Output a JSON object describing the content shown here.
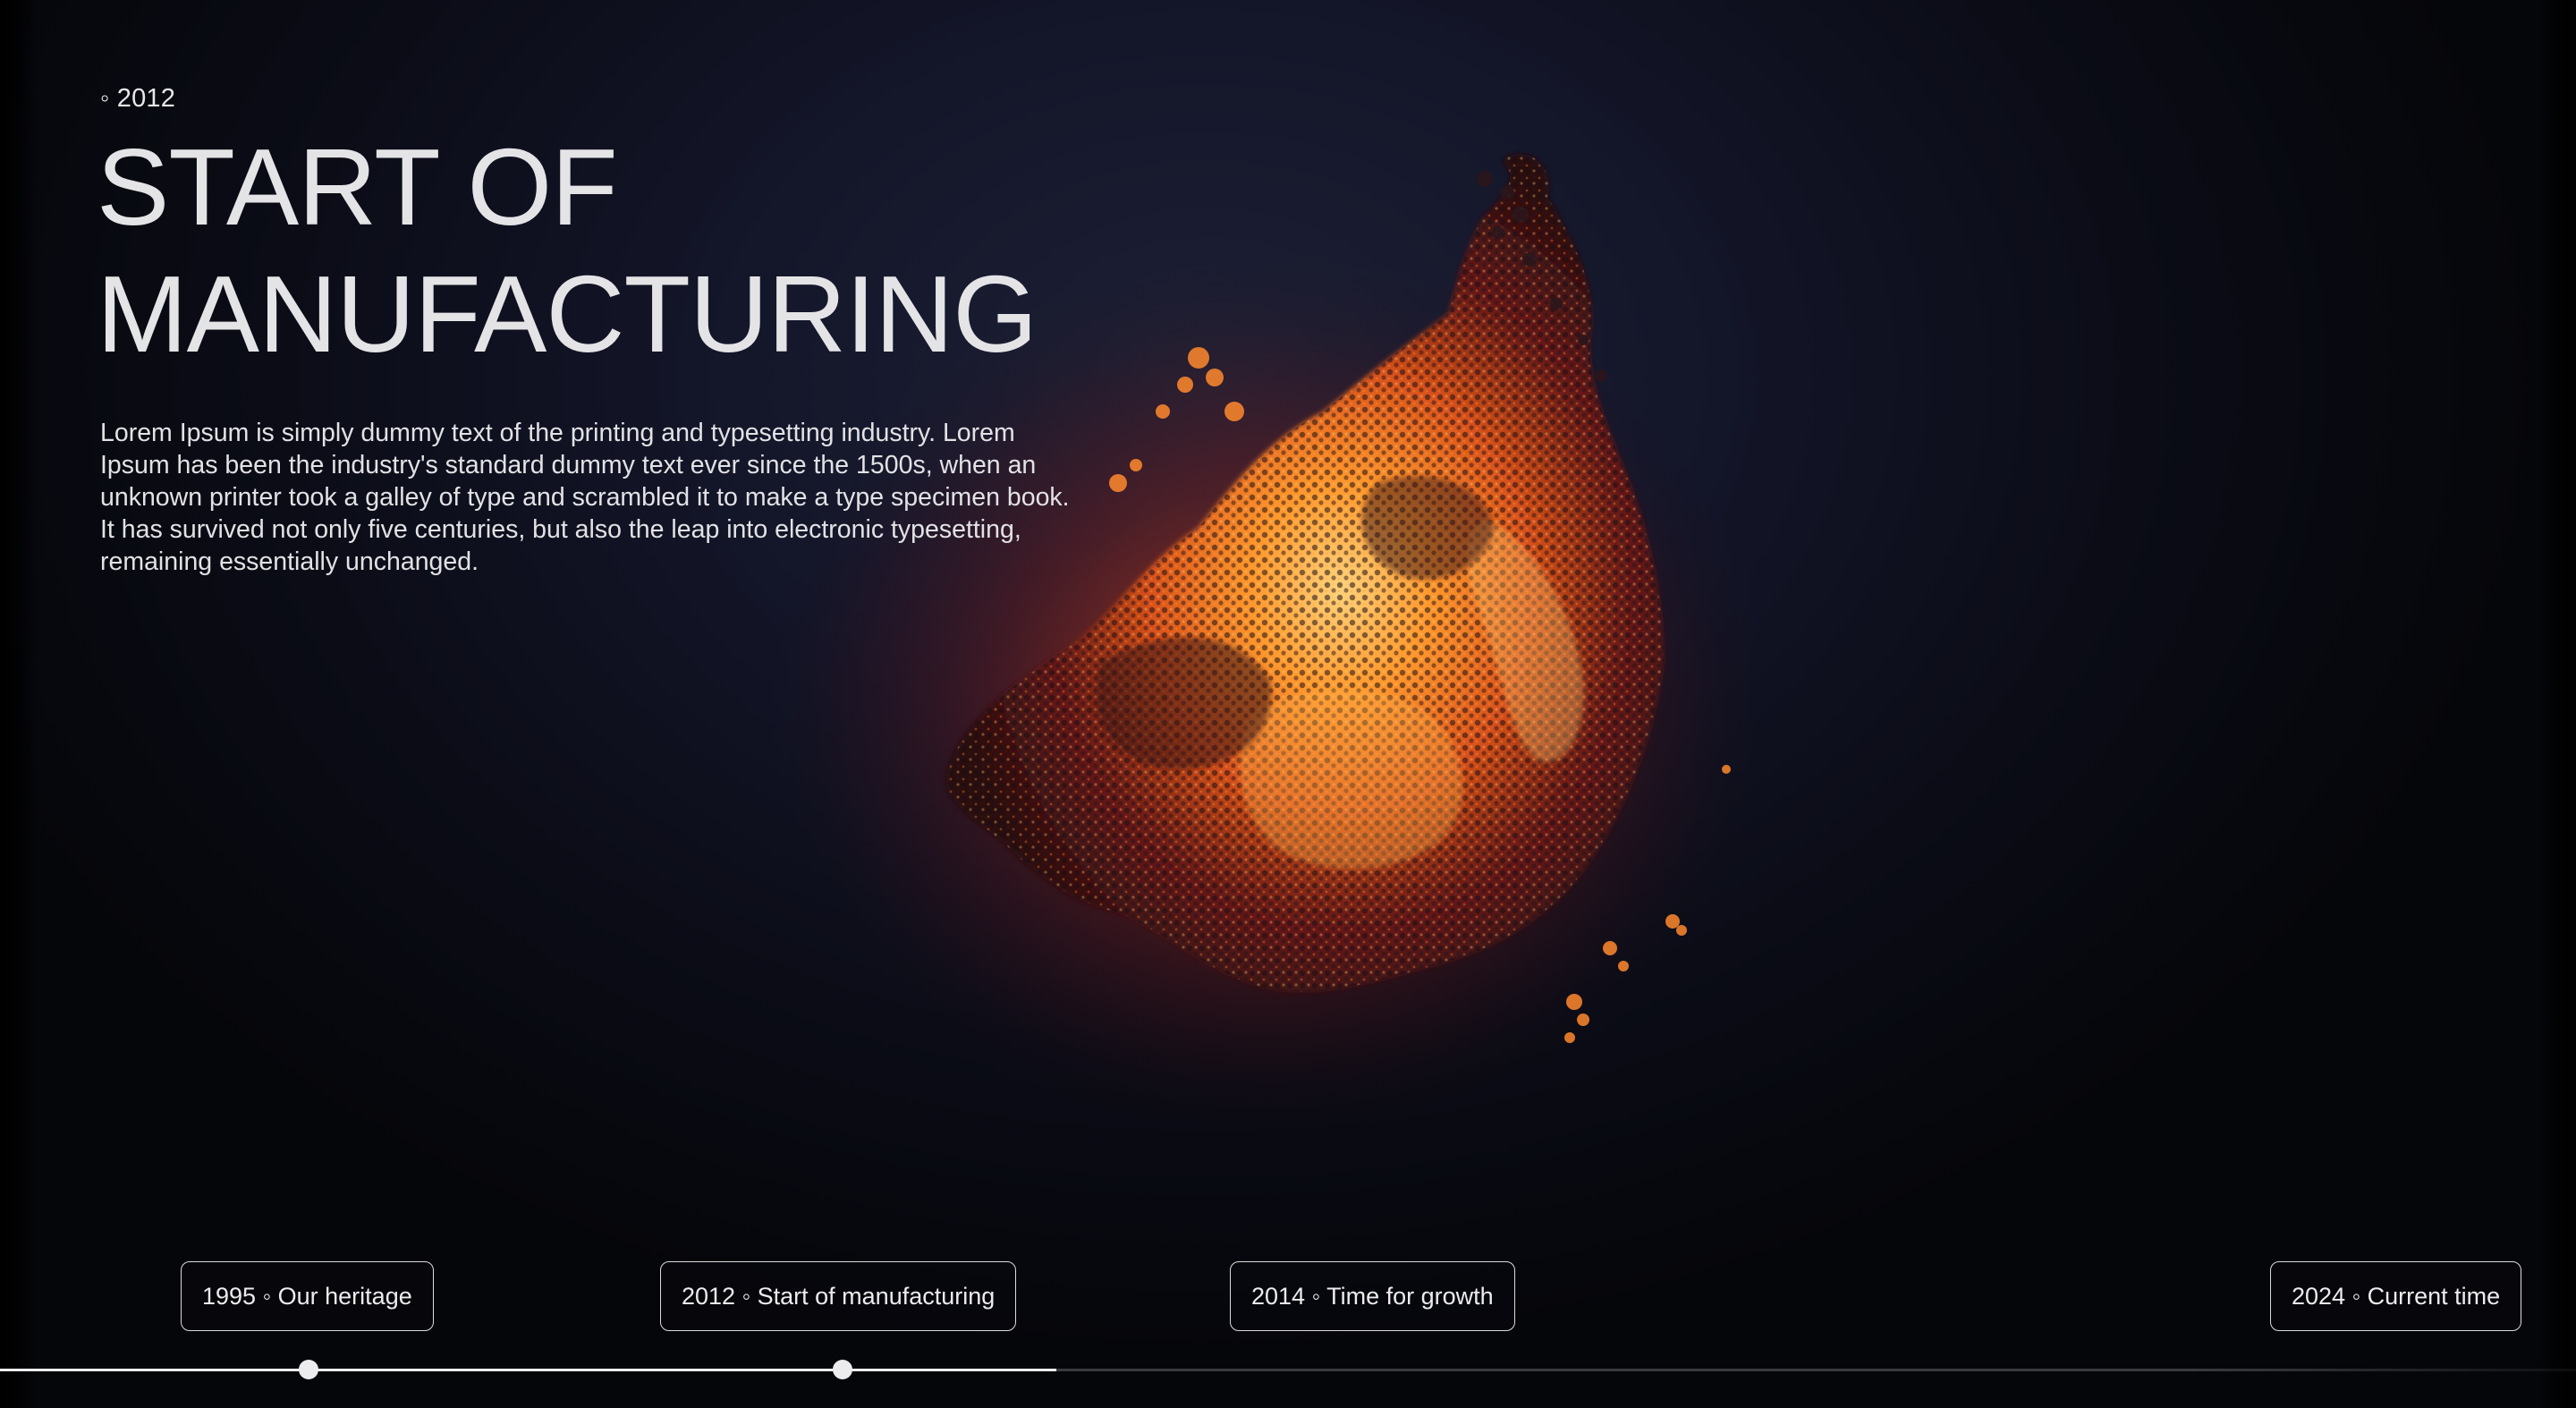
{
  "hero": {
    "eyebrow": "◦ 2012",
    "title_line1": "START OF",
    "title_line2": "MANUFACTURING",
    "description": "Lorem Ipsum is simply dummy text of the printing and typesetting industry. Lorem Ipsum has been the industry's standard dummy text ever since the 1500s, when an unknown printer took a galley of type and scrambled it to make a type specimen book. It has survived not only five centuries, but also the leap into electronic typesetting, remaining essentially unchanged."
  },
  "timeline": {
    "milestones": [
      {
        "label": "1995 ◦ Our heritage"
      },
      {
        "label": "2012 ◦ Start of manufacturing"
      },
      {
        "label": "2014 ◦ Time for growth"
      },
      {
        "label": "2024 ◦ Current time"
      }
    ],
    "progress": 0.41,
    "active_index": 1
  },
  "colors": {
    "background": "#14162a",
    "text": "#e4e4e6",
    "glow_hot": "#ffb347",
    "glow_mid": "#ff7a1a",
    "glow_dark": "#5a1712"
  },
  "icons": {
    "bullet": "small-ring-icon"
  }
}
